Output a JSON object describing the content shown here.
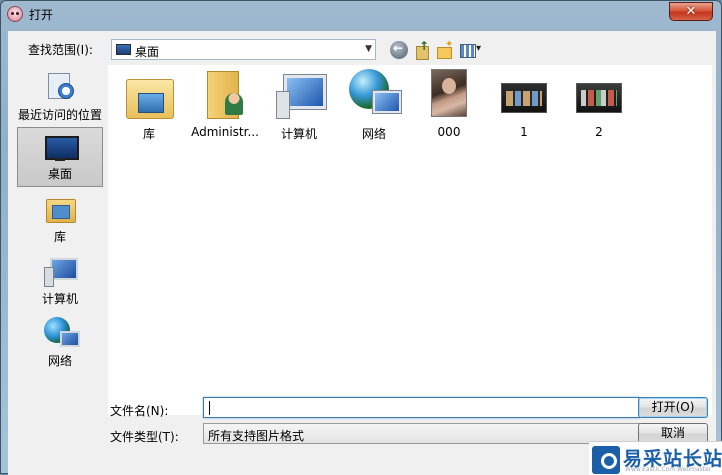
{
  "window": {
    "title": "打开",
    "close_glyph": "✕"
  },
  "toolbar": {
    "look_in_label": "查找范围(I):",
    "look_in_value": "桌面"
  },
  "places": [
    {
      "label": "最近访问的位置",
      "icon": "recent-places-icon"
    },
    {
      "label": "桌面",
      "icon": "desktop-icon",
      "selected": true
    },
    {
      "label": "库",
      "icon": "libraries-icon"
    },
    {
      "label": "计算机",
      "icon": "computer-icon"
    },
    {
      "label": "网络",
      "icon": "network-icon"
    }
  ],
  "files": [
    {
      "label": "库",
      "icon": "libraries-folder-icon"
    },
    {
      "label": "Administr...",
      "icon": "user-folder-icon"
    },
    {
      "label": "计算机",
      "icon": "computer-icon"
    },
    {
      "label": "网络",
      "icon": "network-icon"
    },
    {
      "label": "000",
      "icon": "photo-thumbnail"
    },
    {
      "label": "1",
      "icon": "screenshot-thumbnail"
    },
    {
      "label": "2",
      "icon": "screenshot-thumbnail"
    }
  ],
  "form": {
    "filename_label": "文件名(N):",
    "filename_value": "",
    "filetype_label": "文件类型(T):",
    "filetype_value": "所有支持图片格式",
    "open_button": "打开(O)",
    "cancel_button": "取消"
  },
  "watermark": {
    "text": "易采站长站",
    "sub": "Www.Easck.Com Webmaster"
  }
}
